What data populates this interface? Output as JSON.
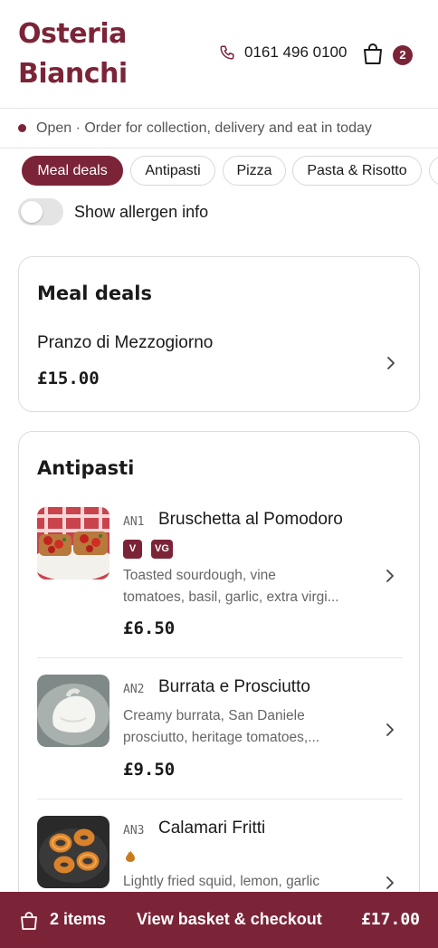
{
  "header": {
    "brand_line1": "Osteria",
    "brand_line2": "Bianchi",
    "phone": "0161 496 0100",
    "basket_count": "2"
  },
  "status": {
    "text": "Open · Order for collection, delivery and eat in today"
  },
  "tabs": [
    {
      "label": "Meal deals",
      "active": true
    },
    {
      "label": "Antipasti",
      "active": false
    },
    {
      "label": "Pizza",
      "active": false
    },
    {
      "label": "Pasta & Risotto",
      "active": false
    }
  ],
  "allergen": {
    "label": "Show allergen info",
    "enabled": false
  },
  "meal_deals": {
    "title": "Meal deals",
    "item_name": "Pranzo di Mezzogiorno",
    "item_price": "£15.00"
  },
  "antipasti": {
    "title": "Antipasti",
    "items": [
      {
        "code": "AN1",
        "name": "Bruschetta al Pomodoro",
        "tags": [
          "V",
          "VG"
        ],
        "desc_line1": "Toasted sourdough, vine",
        "desc_line2": "tomatoes, basil, garlic, extra virgi...",
        "price": "£6.50"
      },
      {
        "code": "AN2",
        "name": "Burrata e Prosciutto",
        "tags": [],
        "desc_line1": "Creamy burrata, San Daniele",
        "desc_line2": "prosciutto, heritage tomatoes,...",
        "price": "£9.50"
      },
      {
        "code": "AN3",
        "name": "Calamari Fritti",
        "tags": [],
        "spicy_icon": "chilli-icon",
        "desc_line1": "Lightly fried squid, lemon, garlic"
      }
    ]
  },
  "footer": {
    "items": "2 items",
    "cta": "View basket & checkout",
    "total": "£17.00"
  },
  "colors": {
    "brand": "#7b2438",
    "muted_text": "#666666",
    "border": "#dcdcdc"
  }
}
